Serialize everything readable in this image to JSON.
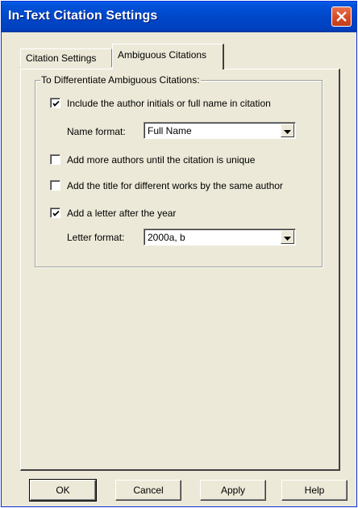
{
  "window": {
    "title": "In-Text Citation Settings"
  },
  "tabs": [
    {
      "label": "Citation Settings"
    },
    {
      "label": "Ambiguous Citations"
    }
  ],
  "group": {
    "legend": "To Differentiate Ambiguous Citations:"
  },
  "options": {
    "include_author": {
      "label": "Include the author initials or full name in citation",
      "checked": true
    },
    "name_format": {
      "label": "Name format:",
      "value": "Full Name"
    },
    "more_authors": {
      "label": "Add more authors until the citation is unique",
      "checked": false
    },
    "add_title": {
      "label": "Add the title for different works by the same author",
      "checked": false
    },
    "add_letter": {
      "label": "Add a letter after the year",
      "checked": true
    },
    "letter_format": {
      "label": "Letter format:",
      "value": "2000a, b"
    }
  },
  "buttons": {
    "ok": "OK",
    "cancel": "Cancel",
    "apply": "Apply",
    "help": "Help"
  },
  "icons": {
    "close": "close-icon",
    "check": "checkmark-icon",
    "dropdown": "chevron-down-icon"
  },
  "colors": {
    "titlebar": "#0047c8",
    "close_button": "#d84e2a",
    "face": "#ece9d8"
  }
}
